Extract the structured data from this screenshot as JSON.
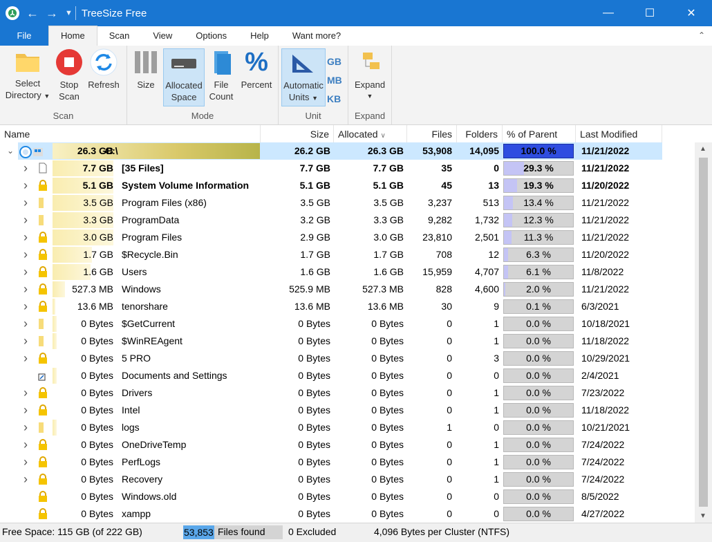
{
  "window": {
    "title": "TreeSize Free"
  },
  "tabs": [
    "File",
    "Home",
    "Scan",
    "View",
    "Options",
    "Help",
    "Want more?"
  ],
  "ribbon": {
    "select_directory": [
      "Select",
      "Directory"
    ],
    "stop_scan": [
      "Stop",
      "Scan"
    ],
    "refresh": "Refresh",
    "size": "Size",
    "allocated_space": [
      "Allocated",
      "Space"
    ],
    "file_count": [
      "File",
      "Count"
    ],
    "percent": "Percent",
    "automatic_units": [
      "Automatic",
      "Units"
    ],
    "unit_gb": "GB",
    "unit_mb": "MB",
    "unit_kb": "KB",
    "expand": "Expand",
    "groups": {
      "scan": "Scan",
      "mode": "Mode",
      "unit": "Unit",
      "expand": "Expand"
    }
  },
  "columns": {
    "name": "Name",
    "size": "Size",
    "allocated": "Allocated",
    "files": "Files",
    "folders": "Folders",
    "percent": "% of Parent (...",
    "modified": "Last Modified"
  },
  "rows": [
    {
      "ex": "v",
      "icon": "drive",
      "bar": "26.3 GB",
      "name": "C:\\",
      "size": "26.2 GB",
      "alloc": "26.3 GB",
      "files": "53,908",
      "folders": "14,095",
      "pct": "100.0 %",
      "frac": 1.0,
      "mod": "11/21/2022",
      "bold": true,
      "sel": true
    },
    {
      "ex": ">",
      "icon": "file",
      "bar": "7.7 GB",
      "name": "[35 Files]",
      "size": "7.7 GB",
      "alloc": "7.7 GB",
      "files": "35",
      "folders": "0",
      "pct": "29.3 %",
      "frac": 0.293,
      "mod": "11/21/2022",
      "bold": true
    },
    {
      "ex": ">",
      "icon": "lock",
      "bar": "5.1 GB",
      "name": "System Volume Information",
      "size": "5.1 GB",
      "alloc": "5.1 GB",
      "files": "45",
      "folders": "13",
      "pct": "19.3 %",
      "frac": 0.193,
      "mod": "11/20/2022",
      "bold": true
    },
    {
      "ex": ">",
      "icon": "folder",
      "bar": "3.5 GB",
      "name": "Program Files (x86)",
      "size": "3.5 GB",
      "alloc": "3.5 GB",
      "files": "3,237",
      "folders": "513",
      "pct": "13.4 %",
      "frac": 0.134,
      "mod": "11/21/2022"
    },
    {
      "ex": ">",
      "icon": "folder",
      "bar": "3.3 GB",
      "name": "ProgramData",
      "size": "3.2 GB",
      "alloc": "3.3 GB",
      "files": "9,282",
      "folders": "1,732",
      "pct": "12.3 %",
      "frac": 0.123,
      "mod": "11/21/2022"
    },
    {
      "ex": ">",
      "icon": "lock",
      "bar": "3.0 GB",
      "name": "Program Files",
      "size": "2.9 GB",
      "alloc": "3.0 GB",
      "files": "23,810",
      "folders": "2,501",
      "pct": "11.3 %",
      "frac": 0.113,
      "mod": "11/21/2022"
    },
    {
      "ex": ">",
      "icon": "lock",
      "bar": "1.7 GB",
      "name": "$Recycle.Bin",
      "size": "1.7 GB",
      "alloc": "1.7 GB",
      "files": "708",
      "folders": "12",
      "pct": "6.3 %",
      "frac": 0.063,
      "mod": "11/20/2022"
    },
    {
      "ex": ">",
      "icon": "lock",
      "bar": "1.6 GB",
      "name": "Users",
      "size": "1.6 GB",
      "alloc": "1.6 GB",
      "files": "15,959",
      "folders": "4,707",
      "pct": "6.1 %",
      "frac": 0.061,
      "mod": "11/8/2022"
    },
    {
      "ex": ">",
      "icon": "lock",
      "bar": "527.3 MB",
      "name": "Windows",
      "size": "525.9 MB",
      "alloc": "527.3 MB",
      "files": "828",
      "folders": "4,600",
      "pct": "2.0 %",
      "frac": 0.02,
      "mod": "11/21/2022"
    },
    {
      "ex": ">",
      "icon": "lock",
      "bar": "13.6 MB",
      "name": "tenorshare",
      "size": "13.6 MB",
      "alloc": "13.6 MB",
      "files": "30",
      "folders": "9",
      "pct": "0.1 %",
      "frac": 0.001,
      "mod": "6/3/2021"
    },
    {
      "ex": ">",
      "icon": "folder",
      "bar": "0 Bytes",
      "name": "$GetCurrent",
      "size": "0 Bytes",
      "alloc": "0 Bytes",
      "files": "0",
      "folders": "1",
      "pct": "0.0 %",
      "frac": 0,
      "mod": "10/18/2021"
    },
    {
      "ex": ">",
      "icon": "folder",
      "bar": "0 Bytes",
      "name": "$WinREAgent",
      "size": "0 Bytes",
      "alloc": "0 Bytes",
      "files": "0",
      "folders": "1",
      "pct": "0.0 %",
      "frac": 0,
      "mod": "11/18/2022"
    },
    {
      "ex": ">",
      "icon": "lock",
      "bar": "0 Bytes",
      "name": "5 PRO",
      "size": "0 Bytes",
      "alloc": "0 Bytes",
      "files": "0",
      "folders": "3",
      "pct": "0.0 %",
      "frac": 0,
      "mod": "10/29/2021"
    },
    {
      "ex": "",
      "icon": "shortcut",
      "bar": "0 Bytes",
      "name": "Documents and Settings",
      "size": "0 Bytes",
      "alloc": "0 Bytes",
      "files": "0",
      "folders": "0",
      "pct": "0.0 %",
      "frac": 0,
      "mod": "2/4/2021"
    },
    {
      "ex": ">",
      "icon": "lock",
      "bar": "0 Bytes",
      "name": "Drivers",
      "size": "0 Bytes",
      "alloc": "0 Bytes",
      "files": "0",
      "folders": "1",
      "pct": "0.0 %",
      "frac": 0,
      "mod": "7/23/2022"
    },
    {
      "ex": ">",
      "icon": "lock",
      "bar": "0 Bytes",
      "name": "Intel",
      "size": "0 Bytes",
      "alloc": "0 Bytes",
      "files": "0",
      "folders": "1",
      "pct": "0.0 %",
      "frac": 0,
      "mod": "11/18/2022"
    },
    {
      "ex": ">",
      "icon": "folder",
      "bar": "0 Bytes",
      "name": "logs",
      "size": "0 Bytes",
      "alloc": "0 Bytes",
      "files": "1",
      "folders": "0",
      "pct": "0.0 %",
      "frac": 0,
      "mod": "10/21/2021"
    },
    {
      "ex": ">",
      "icon": "lock",
      "bar": "0 Bytes",
      "name": "OneDriveTemp",
      "size": "0 Bytes",
      "alloc": "0 Bytes",
      "files": "0",
      "folders": "1",
      "pct": "0.0 %",
      "frac": 0,
      "mod": "7/24/2022"
    },
    {
      "ex": ">",
      "icon": "lock",
      "bar": "0 Bytes",
      "name": "PerfLogs",
      "size": "0 Bytes",
      "alloc": "0 Bytes",
      "files": "0",
      "folders": "1",
      "pct": "0.0 %",
      "frac": 0,
      "mod": "7/24/2022"
    },
    {
      "ex": ">",
      "icon": "lock",
      "bar": "0 Bytes",
      "name": "Recovery",
      "size": "0 Bytes",
      "alloc": "0 Bytes",
      "files": "0",
      "folders": "1",
      "pct": "0.0 %",
      "frac": 0,
      "mod": "7/24/2022"
    },
    {
      "ex": "",
      "icon": "lock",
      "bar": "0 Bytes",
      "name": "Windows.old",
      "size": "0 Bytes",
      "alloc": "0 Bytes",
      "files": "0",
      "folders": "0",
      "pct": "0.0 %",
      "frac": 0,
      "mod": "8/5/2022"
    },
    {
      "ex": "",
      "icon": "lock",
      "bar": "0 Bytes",
      "name": "xampp",
      "size": "0 Bytes",
      "alloc": "0 Bytes",
      "files": "0",
      "folders": "0",
      "pct": "0.0 %",
      "frac": 0,
      "mod": "4/27/2022"
    }
  ],
  "status": {
    "free_space": "Free Space: 115 GB  (of 222 GB)",
    "files_found_count": "53,853",
    "files_found_label": " Files found",
    "excluded": "0 Excluded",
    "cluster": "4,096 Bytes per Cluster (NTFS)"
  },
  "colors": {
    "accent": "#1976d2",
    "selection": "#cce8ff",
    "percent_fill": "#c4c4f5",
    "percent_fill_root": "#2e4de0"
  }
}
